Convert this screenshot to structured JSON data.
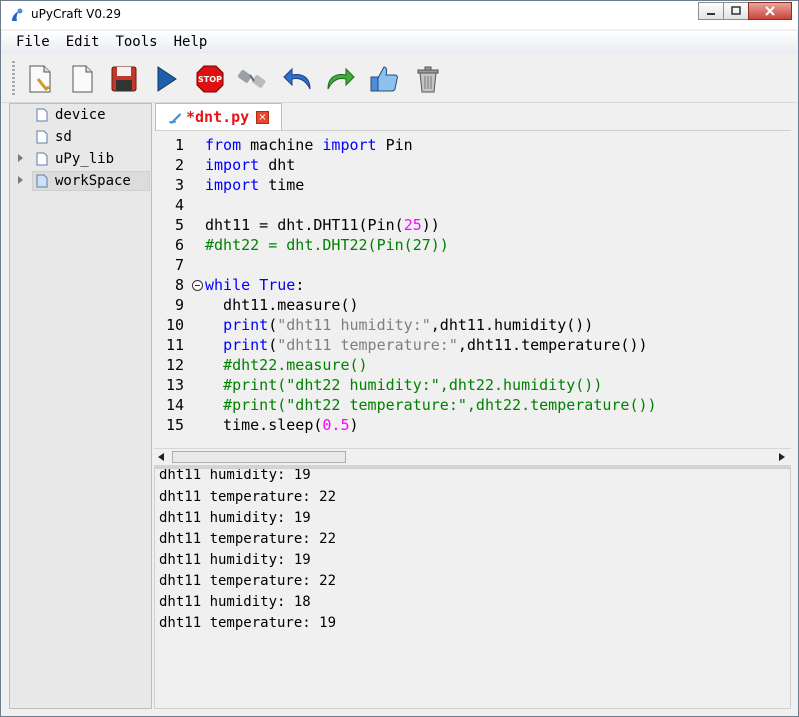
{
  "window": {
    "title": "uPyCraft V0.29"
  },
  "menu": {
    "items": [
      "File",
      "Edit",
      "Tools",
      "Help"
    ]
  },
  "toolbar": {
    "buttons": [
      "new-file",
      "open-file",
      "save",
      "download-run",
      "stop",
      "connect",
      "undo",
      "redo",
      "syntax-check",
      "clear"
    ]
  },
  "sidebar": {
    "items": [
      {
        "label": "device",
        "expandable": false
      },
      {
        "label": "sd",
        "expandable": false
      },
      {
        "label": "uPy_lib",
        "expandable": true
      },
      {
        "label": "workSpace",
        "expandable": true,
        "selected": true
      }
    ]
  },
  "editor": {
    "tab_label": "*dnt.py",
    "line_numbers": [
      "1",
      "2",
      "3",
      "4",
      "5",
      "6",
      "7",
      "8",
      "9",
      "10",
      "11",
      "12",
      "13",
      "14",
      "15"
    ],
    "lines": [
      "from machine import Pin",
      "import dht",
      "import time",
      "",
      "dht11 = dht.DHT11(Pin(25))",
      "#dht22 = dht.DHT22(Pin(27))",
      "",
      "while True:",
      "  dht11.measure()",
      "  print(\"dht11 humidity:\",dht11.humidity())",
      "  print(\"dht11 temperature:\",dht11.temperature())",
      "  #dht22.measure()",
      "  #print(\"dht22 humidity:\",dht22.humidity())",
      "  #print(\"dht22 temperature:\",dht22.temperature())",
      "  time.sleep(0.5)"
    ]
  },
  "console": {
    "lines": [
      "dht11 humidity: 19",
      "dht11 temperature: 22",
      "dht11 humidity: 19",
      "dht11 temperature: 22",
      "dht11 humidity: 19",
      "dht11 temperature: 22",
      "dht11 humidity: 18",
      "dht11 temperature: 19"
    ]
  },
  "colors": {
    "keyword": "#0000ff",
    "number": "#ff00ff",
    "string": "#7f7f7f",
    "comment": "#008000",
    "tab_label": "#e8131b"
  }
}
